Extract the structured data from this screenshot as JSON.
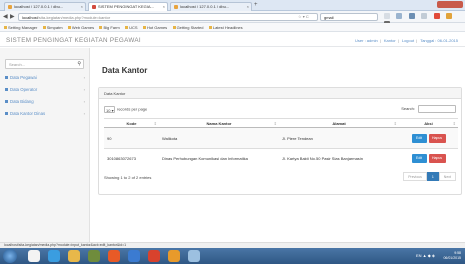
{
  "browser": {
    "tabs": [
      {
        "label": "localhost / 127.0.0.1 / dbu...",
        "active": false
      },
      {
        "label": "SISTEM PENGINGAT KEGIA...",
        "active": true
      },
      {
        "label": "localhost / 127.0.0.1 / dbu...",
        "active": false
      }
    ],
    "new_tab": "+",
    "url_host": "localhost",
    "url_path": "/sita-kegiatan/media.php?module=kantor",
    "search_value": "gmail",
    "bookmarks": [
      "Setting Manager",
      "Simpatm",
      "Web Games",
      "Big Farm",
      "UCS",
      "Hot Games",
      "Getting Started",
      "Latest Headlines"
    ]
  },
  "app": {
    "title": "SISTEM PENGINGAT KEGIATAN PEGAWAI",
    "user": "User : admin",
    "user_role": "Kantor",
    "logout": "Logout",
    "date": "Tanggal : 06-01-2015"
  },
  "sidebar": {
    "search_placeholder": "Search...",
    "items": [
      {
        "label": "Data Pegawai"
      },
      {
        "label": "Data Operator"
      },
      {
        "label": "Data Bidang"
      },
      {
        "label": "Data Kantor Dinas"
      }
    ]
  },
  "main": {
    "heading": "Data Kantor",
    "panel_title": "Data Kantor",
    "page_size": "10",
    "per_page_label": "records per page",
    "search_label": "Search:",
    "columns": [
      "Kode",
      "Nama Kantor",
      "Alamat",
      "Aksi"
    ],
    "rows": [
      {
        "kode": "90",
        "nama": "Walikota",
        "alamat": "Jl. Piere Tendean"
      },
      {
        "kode": "3010863072673",
        "nama": "Dinas Perhubungan Komunikasi dan Informatika",
        "alamat": "Jl. Kartya Bakti No.50 Pasir Sias Banjarmasin"
      }
    ],
    "edit_label": "Edit",
    "delete_label": "Hapus",
    "showing": "Showing 1 to 2 of 2 entries",
    "pager": {
      "prev": "Previous",
      "current": "1",
      "next": "Next"
    }
  },
  "statusbar": "localhost/sita-kegiatan/media.php?module=input_kantor&act=edit_kantor&id=1",
  "taskbar": {
    "tray_text": "EN",
    "time": "9:58",
    "date": "06/01/2015"
  },
  "colors": {
    "accent": "#5a8ec7",
    "edit": "#2e8fd3",
    "delete": "#d9534f",
    "taskbar": "#2f5784"
  }
}
